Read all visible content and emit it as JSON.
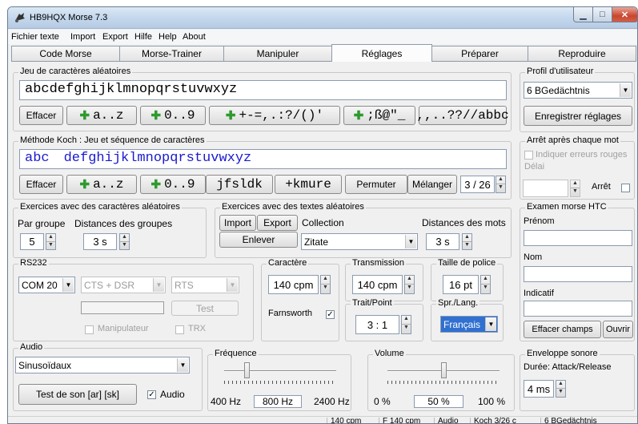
{
  "window": {
    "title": "HB9HQX Morse 7.3"
  },
  "menu": [
    "Fichier texte",
    "Import",
    "Export",
    "Hilfe",
    "Help",
    "About"
  ],
  "tabs": [
    "Code Morse",
    "Morse-Trainer",
    "Manipuler",
    "Réglages",
    "Préparer",
    "Reproduire"
  ],
  "active_tab": "Réglages",
  "random_chars": {
    "label": "Jeu de caractères aléatoires",
    "text": "abcdefghijklmnopqrstuvwxyz",
    "buttons": {
      "clear": "Effacer",
      "az": "a..z",
      "digits": "0..9",
      "punct1": "+-=,.:?/()'",
      "special": ";ß@\"_",
      "custom": ",,..??//abbc"
    }
  },
  "koch": {
    "label": "Méthode Koch : Jeu et séquence de caractères",
    "prefix": "abc",
    "text": "defghijklmnopqrstuvwxyz",
    "buttons": {
      "clear": "Effacer",
      "az": "a..z",
      "digits": "0..9",
      "set1": "jfsldk",
      "set2": "+kmure",
      "permute": "Permuter",
      "shuffle": "Mélanger"
    },
    "counter": "3 / 26"
  },
  "exercises_random": {
    "label": "Exercices avec des caractères aléatoires",
    "per_group_label": "Par groupe",
    "per_group": "5",
    "distance_label": "Distances des groupes",
    "distance": "3 s"
  },
  "exercises_text": {
    "label": "Exercices avec des textes aléatoires",
    "import": "Import",
    "export": "Export",
    "collection_label": "Collection",
    "remove": "Enlever",
    "collection": "Zitate",
    "word_distance_label": "Distances des mots",
    "word_distance": "3 s"
  },
  "rs232": {
    "label": "RS232",
    "port": "COM 20",
    "handshake": "CTS + DSR",
    "line": "RTS",
    "test": "Test",
    "key_label": "Manipulateur",
    "trx_label": "TRX"
  },
  "character": {
    "label": "Caractère",
    "speed": "140 cpm",
    "farnsworth": "Farnsworth",
    "farnsworth_checked": "✓"
  },
  "transmission": {
    "label": "Transmission",
    "speed": "140 cpm"
  },
  "font_size": {
    "label": "Taille de police",
    "value": "16 pt"
  },
  "dot_dash": {
    "label": "Trait/Point",
    "value": "3 : 1"
  },
  "lang": {
    "label": "Spr./Lang.",
    "value": "Français"
  },
  "audio": {
    "label": "Audio",
    "waveform": "Sinusoïdaux",
    "test": "Test de son  [ar] [sk]",
    "audio_label": "Audio",
    "audio_checked": "✓"
  },
  "frequency": {
    "label": "Fréquence",
    "min": "400 Hz",
    "value": "800 Hz",
    "max": "2400 Hz",
    "level": 0.2
  },
  "volume": {
    "label": "Volume",
    "min": "0 %",
    "value": "50 %",
    "max": "100 %",
    "level": 0.5
  },
  "profile": {
    "label": "Profil d'utilisateur",
    "value": "6 BGedächtnis",
    "save": "Enregistrer réglages"
  },
  "stop": {
    "label": "Arrêt après chaque mot",
    "show_errors": "Indiquer erreurs rouges",
    "delay": "Délai",
    "stop": "Arrêt"
  },
  "htc": {
    "label": "Examen morse HTC",
    "first_name": "Prénom",
    "name": "Nom",
    "callsign": "Indicatif",
    "clear": "Effacer champs",
    "open": "Ouvrir"
  },
  "envelope": {
    "label": "Enveloppe sonore",
    "duration_label": "Durée: Attack/Release",
    "value": "4 ms"
  },
  "status": [
    "140 cpm",
    "F 140 cpm",
    "Audio",
    "Koch 3/26  c",
    "6 BGedächtnis"
  ],
  "colors": {
    "koch_text": "#1a1ad0",
    "accent_green": "#2e9a2e",
    "selection": "#3070d0"
  }
}
